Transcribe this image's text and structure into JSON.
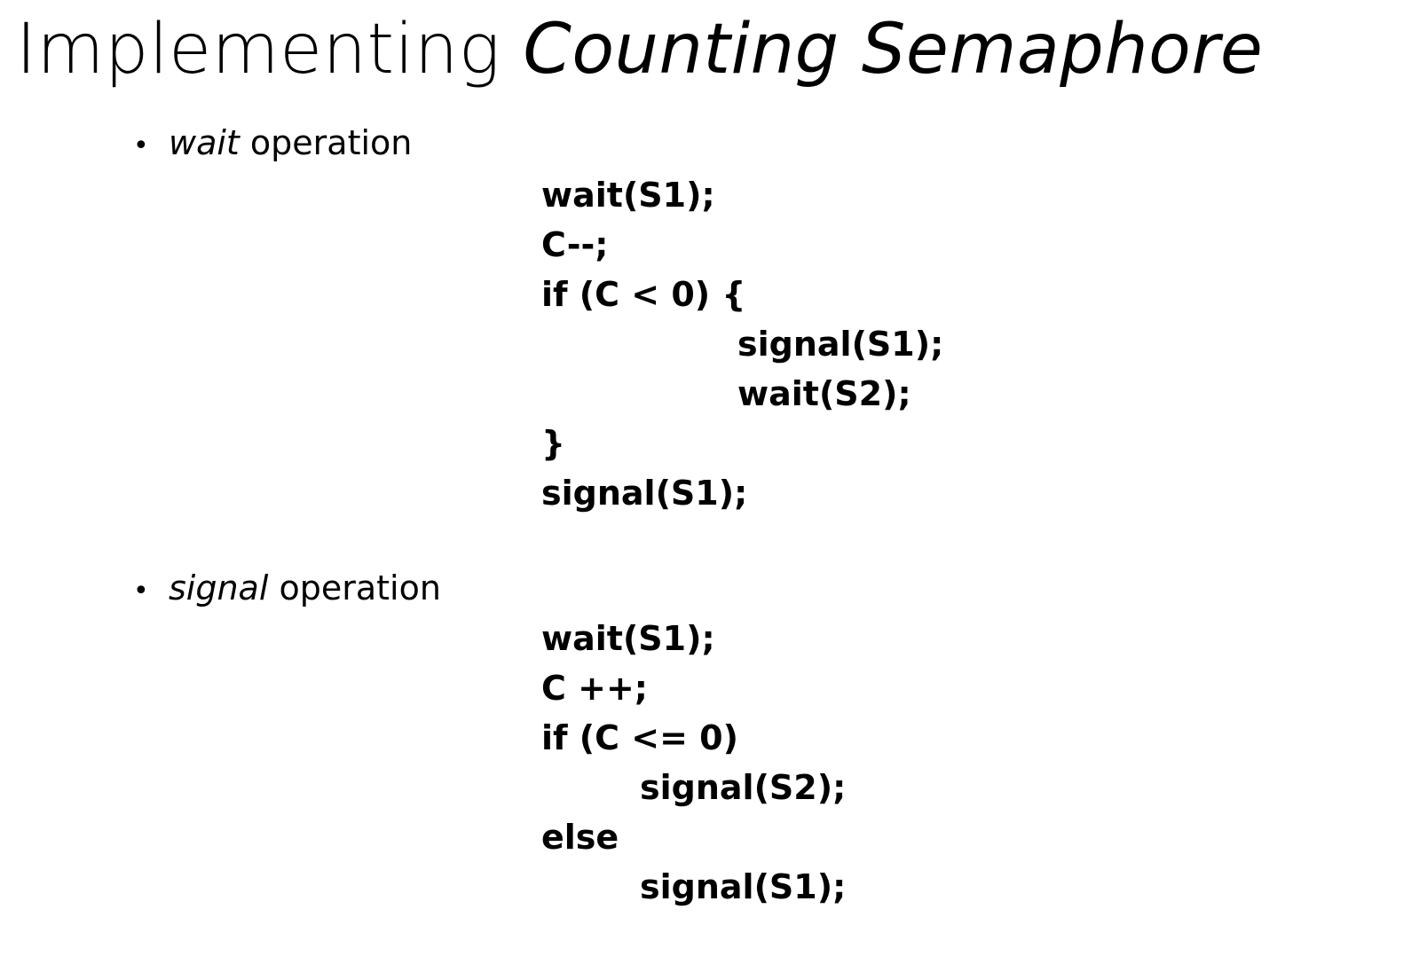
{
  "title": {
    "prefix": "Implementing ",
    "emphasis": "Counting Semaphore"
  },
  "wait_operation": {
    "bullet": "•",
    "name": "wait",
    "suffix": " operation",
    "code": [
      "wait(S1);",
      "C--;",
      "if (C < 0) {",
      "signal(S1);",
      "wait(S2);",
      "}",
      "signal(S1);"
    ]
  },
  "signal_operation": {
    "bullet": "•",
    "name": "signal",
    "suffix": " operation",
    "code": [
      "wait(S1);",
      "C ++;",
      "if (C <= 0)",
      "signal(S2);",
      "else",
      "signal(S1);"
    ]
  }
}
